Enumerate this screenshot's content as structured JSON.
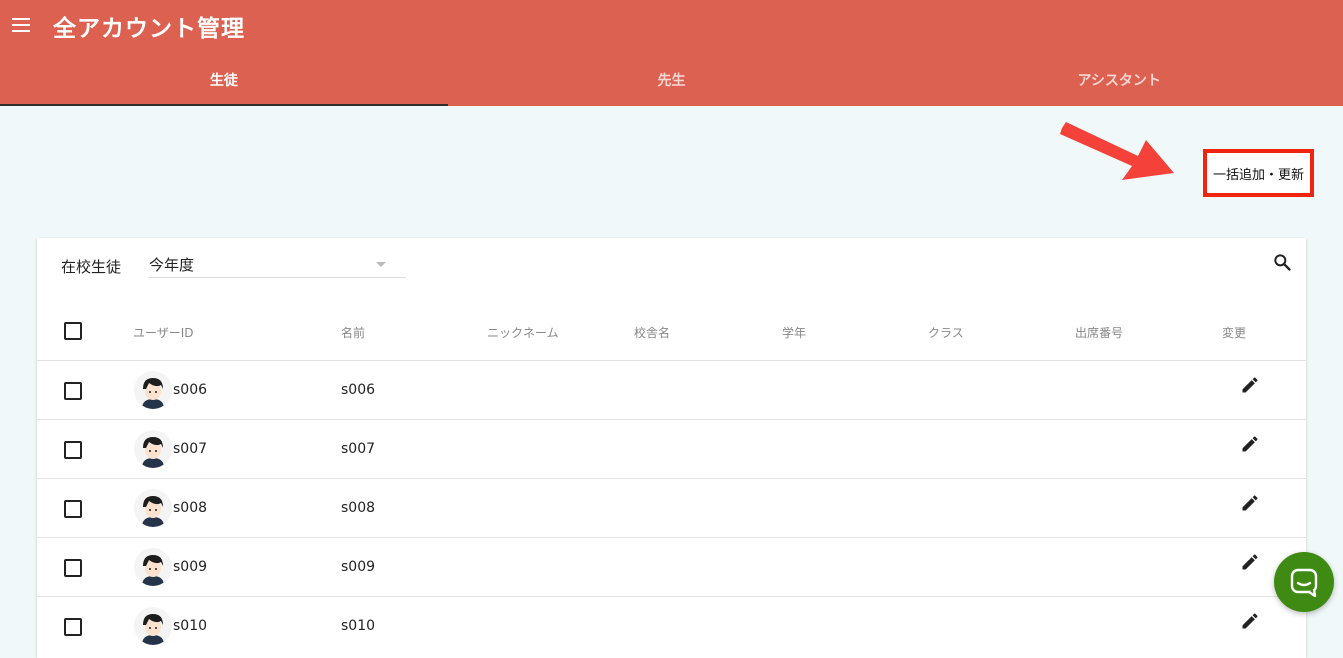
{
  "header": {
    "title": "全アカウント管理",
    "tabs": [
      {
        "label": "生徒",
        "active": true
      },
      {
        "label": "先生",
        "active": false
      },
      {
        "label": "アシスタント",
        "active": false
      }
    ]
  },
  "bulk_button": {
    "label": "一括追加・更新"
  },
  "filter": {
    "label": "在校生徒",
    "year_select": "今年度"
  },
  "table": {
    "columns": [
      "ユーザーID",
      "名前",
      "ニックネーム",
      "校舎名",
      "学年",
      "クラス",
      "出席番号",
      "変更"
    ],
    "rows": [
      {
        "user_id": "s006",
        "name": "s006"
      },
      {
        "user_id": "s007",
        "name": "s007"
      },
      {
        "user_id": "s008",
        "name": "s008"
      },
      {
        "user_id": "s009",
        "name": "s009"
      },
      {
        "user_id": "s010",
        "name": "s010"
      }
    ]
  },
  "icons": {
    "menu": "menu-icon",
    "search": "search-icon",
    "edit": "pencil-icon",
    "chat": "chat-icon",
    "avatar": "student-avatar"
  },
  "colors": {
    "header": "#dd6150",
    "highlight_border": "#f0240f",
    "chat": "#3e8a12",
    "background": "#f1f8f9"
  }
}
